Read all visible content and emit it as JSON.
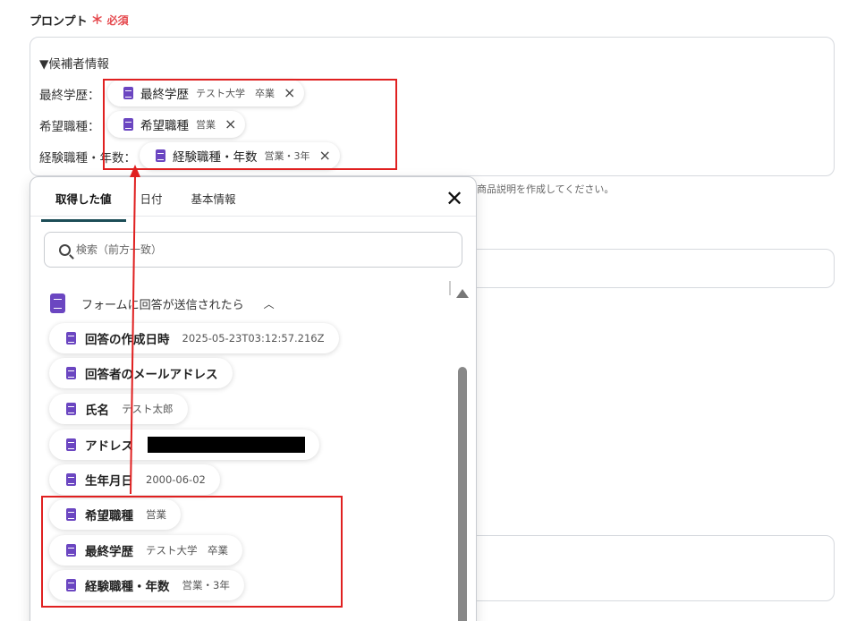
{
  "field": {
    "label": "プロンプト",
    "required_mark": "＊",
    "required_text": "必須"
  },
  "prompt": {
    "heading": "▼候補者情報",
    "rows": [
      {
        "label": "最終学歴：",
        "chip_name": "最終学歴",
        "chip_value": "テスト大学　卒業"
      },
      {
        "label": "希望職種：",
        "chip_name": "希望職種",
        "chip_value": "営業"
      },
      {
        "label": "経験職種・年数：",
        "chip_name": "経験職種・年数",
        "chip_value": "営業・3年"
      }
    ],
    "remove_icon": "×",
    "helper_text": "商品説明を作成してください。"
  },
  "dropdown": {
    "tabs": [
      {
        "label": "取得した値",
        "active": true
      },
      {
        "label": "日付",
        "active": false
      },
      {
        "label": "基本情報",
        "active": false
      }
    ],
    "close_icon": "✕",
    "search_placeholder": "検索（前方一致）",
    "group_title": "フォームに回答が送信されたら",
    "group_chevron": "︿",
    "items": [
      {
        "name": "回答の作成日時",
        "value": "2025-05-23T03:12:57.216Z"
      },
      {
        "name": "回答者のメールアドレス",
        "value": ""
      },
      {
        "name": "氏名",
        "value": "テスト太郎"
      },
      {
        "name": "アドレス",
        "value": "",
        "redacted": true
      },
      {
        "name": "生年月日",
        "value": "2000-06-02"
      },
      {
        "name": "希望職種",
        "value": "営業"
      },
      {
        "name": "最終学歴",
        "value": "テスト大学　卒業"
      },
      {
        "name": "経験職種・年数",
        "value": "営業・3年"
      }
    ]
  },
  "colors": {
    "accent_purple": "#6b46c1",
    "highlight_red": "#e02020",
    "required_red": "#e5484d",
    "active_tab_underline": "#1c4d57"
  }
}
